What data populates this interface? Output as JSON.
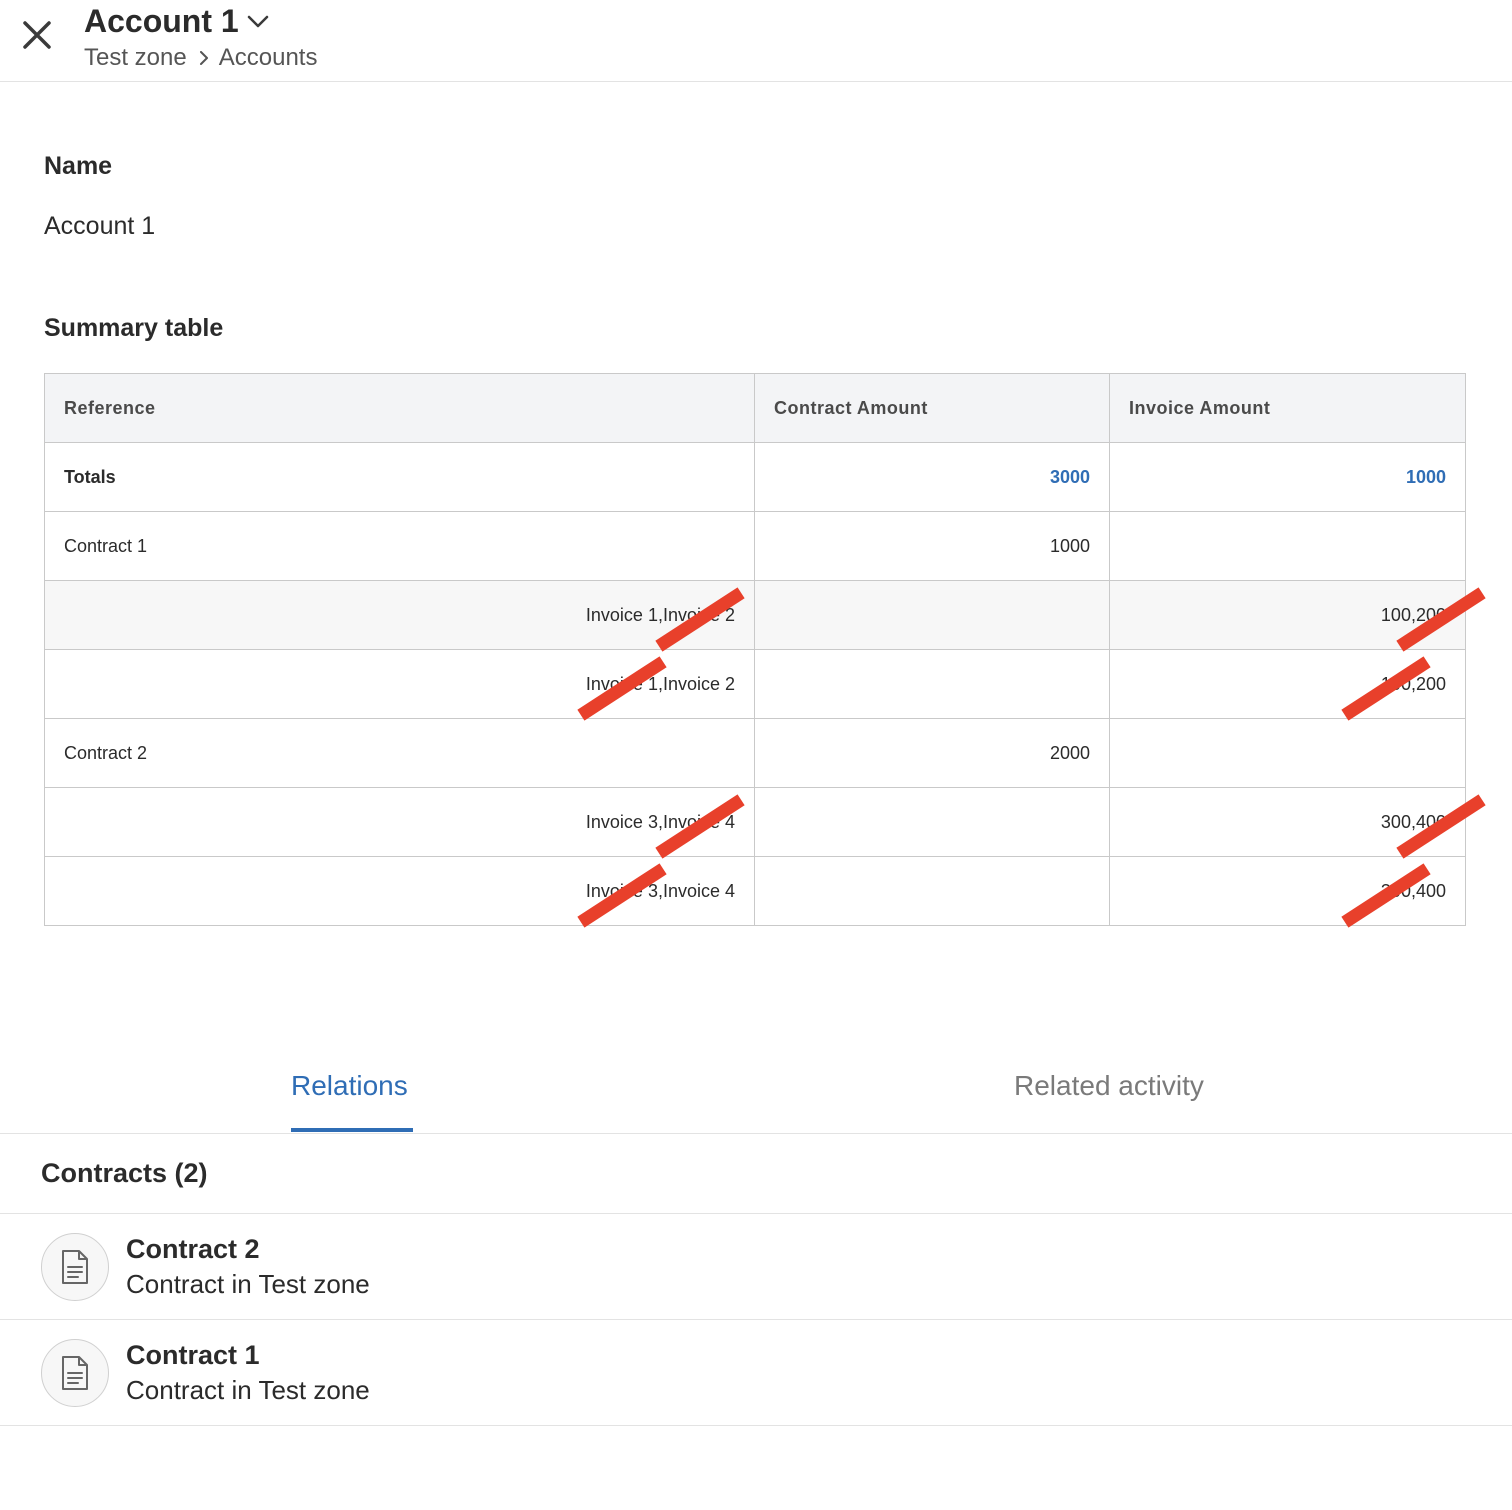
{
  "header": {
    "title": "Account 1",
    "breadcrumb": [
      "Test zone",
      "Accounts"
    ]
  },
  "name_section": {
    "label": "Name",
    "value": "Account 1"
  },
  "summary": {
    "label": "Summary table",
    "columns": [
      "Reference",
      "Contract Amount",
      "Invoice Amount"
    ],
    "totals": {
      "label": "Totals",
      "contract_amount": "3000",
      "invoice_amount": "1000"
    },
    "rows": [
      {
        "reference": "Contract 1",
        "contract_amount": "1000",
        "invoice_amount": ""
      },
      {
        "reference": "Invoice 1,Invoice 2",
        "contract_amount": "",
        "invoice_amount": "100,200"
      },
      {
        "reference": "Invoice 1,Invoice 2",
        "contract_amount": "",
        "invoice_amount": "100,200"
      },
      {
        "reference": "Contract 2",
        "contract_amount": "2000",
        "invoice_amount": ""
      },
      {
        "reference": "Invoice 3,Invoice 4",
        "contract_amount": "",
        "invoice_amount": "300,400"
      },
      {
        "reference": "Invoice 3,Invoice 4",
        "contract_amount": "",
        "invoice_amount": "300,400"
      }
    ]
  },
  "tabs": [
    {
      "label": "Relations",
      "active": true
    },
    {
      "label": "Related activity",
      "active": false
    }
  ],
  "relations": {
    "group_title": "Contracts (2)",
    "items": [
      {
        "title": "Contract 2",
        "subtitle": "Contract in Test zone",
        "icon": "document-icon"
      },
      {
        "title": "Contract 1",
        "subtitle": "Contract in Test zone",
        "icon": "document-icon"
      }
    ]
  },
  "colors": {
    "accent": "#2f6db5",
    "annotation": "#e8402b",
    "header_bg": "#f3f4f6"
  }
}
